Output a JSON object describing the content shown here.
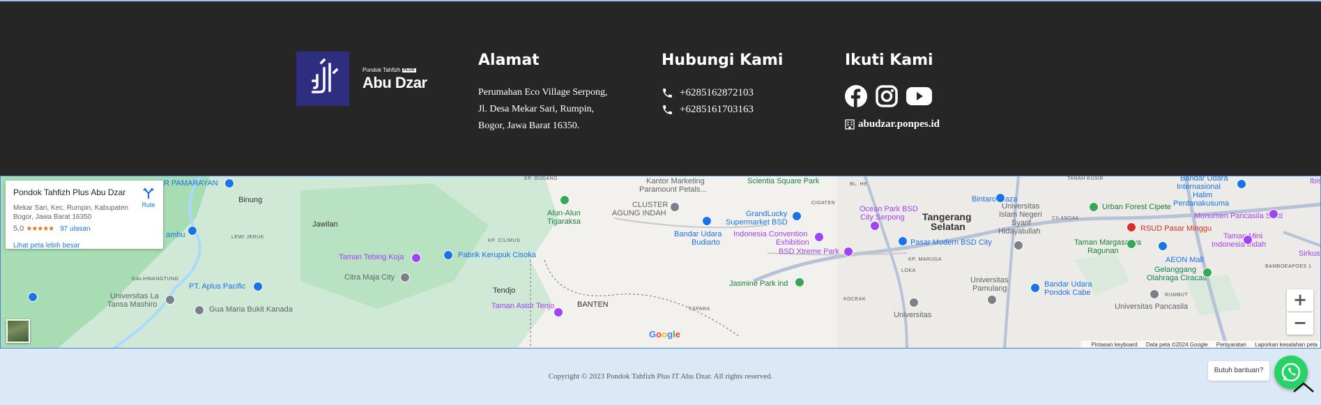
{
  "logo": {
    "small_text": "Pondok Tahfizh",
    "plus_badge": "PLUS",
    "name": "Abu Dzar"
  },
  "address": {
    "title": "Alamat",
    "lines": [
      "Perumahan Eco Village Serpong,",
      "Jl. Desa Mekar Sari, Rumpin,",
      "Bogor, Jawa Barat 16350."
    ]
  },
  "contact": {
    "title": "Hubungi Kami",
    "phones": [
      "+6285162872103",
      "+6285161703163"
    ]
  },
  "social": {
    "title": "Ikuti Kami",
    "icons": [
      "facebook-icon",
      "instagram-icon",
      "youtube-icon"
    ],
    "website": "abudzar.ponpes.id"
  },
  "map": {
    "card": {
      "title": "Pondok Tahfizh Plus Abu Dzar",
      "address": "Mekar Sari, Kec. Rumpin, Kabupaten Bogor, Jawa Barat 16350",
      "rating": "5,0",
      "stars": "★★★★★",
      "reviews": "97 ulasan",
      "larger_map": "Lihat peta lebih besar",
      "route": "Rute"
    },
    "places": [
      {
        "text": "R PAMARAYAN",
        "cls": "p-poi"
      },
      {
        "text": "Binung",
        "cls": "p-town"
      },
      {
        "text": "Jawilan",
        "cls": "p-town"
      },
      {
        "text": "ambu",
        "cls": "p-poi"
      },
      {
        "text": "LEWI JERUK",
        "cls": "p-small"
      },
      {
        "text": "KP. GUDANG",
        "cls": "p-small"
      },
      {
        "text": "Alun-Alun",
        "cls": "p-green"
      },
      {
        "text": "Tigaraksa",
        "cls": "p-green"
      },
      {
        "text": "CLUSTER",
        "cls": "p-gray"
      },
      {
        "text": "AGUNG INDAH",
        "cls": "p-gray"
      },
      {
        "text": "Kantor Marketing",
        "cls": "p-gray"
      },
      {
        "text": "Paramount Petals...",
        "cls": "p-gray"
      },
      {
        "text": "Scientia Square Park",
        "cls": "p-green"
      },
      {
        "text": "BL. H9",
        "cls": "p-small"
      },
      {
        "text": "CIGATEN",
        "cls": "p-small"
      },
      {
        "text": "GrandLucky",
        "cls": "p-poi"
      },
      {
        "text": "Supermarket BSD",
        "cls": "p-poi"
      },
      {
        "text": "Ocean Park BSD",
        "cls": "p-purple"
      },
      {
        "text": "City Serpong",
        "cls": "p-purple"
      },
      {
        "text": "Tangerang",
        "cls": "p-big"
      },
      {
        "text": "Selatan",
        "cls": "p-big"
      },
      {
        "text": "Bintaro Plaza",
        "cls": "p-poi"
      },
      {
        "text": "Universitas",
        "cls": "p-gray"
      },
      {
        "text": "Islam Negeri",
        "cls": "p-gray"
      },
      {
        "text": "Syarif",
        "cls": "p-gray"
      },
      {
        "text": "Hidayatullah",
        "cls": "p-gray"
      },
      {
        "text": "CILANDAK",
        "cls": "p-small"
      },
      {
        "text": "TANAH KUSIR",
        "cls": "p-small"
      },
      {
        "text": "Bandar Udara",
        "cls": "p-poi"
      },
      {
        "text": "Internasional",
        "cls": "p-poi"
      },
      {
        "text": "Halim",
        "cls": "p-poi"
      },
      {
        "text": "Perdanakusuma",
        "cls": "p-poi"
      },
      {
        "text": "Ibis",
        "cls": "p-purple"
      },
      {
        "text": "Urban Forest Cipete",
        "cls": "p-green"
      },
      {
        "text": "Monumen Pancasila Sakti",
        "cls": "p-purple"
      },
      {
        "text": "RSUD Pasar Minggu",
        "cls": "p-red"
      },
      {
        "text": "KP. CILIMUS",
        "cls": "p-small"
      },
      {
        "text": "Bandar Udara",
        "cls": "p-poi"
      },
      {
        "text": "Budiarto",
        "cls": "p-poi"
      },
      {
        "text": "Indonesia Convention",
        "cls": "p-purple"
      },
      {
        "text": "Exhibition",
        "cls": "p-purple"
      },
      {
        "text": "Pasar Modern BSD City",
        "cls": "p-poi"
      },
      {
        "text": "Taman Margasatwa",
        "cls": "p-green"
      },
      {
        "text": "Ragunan",
        "cls": "p-green"
      },
      {
        "text": "Taman Mini",
        "cls": "p-purple"
      },
      {
        "text": "Indonesia Indah",
        "cls": "p-purple"
      },
      {
        "text": "Taman Tebing Koja",
        "cls": "p-purple"
      },
      {
        "text": "Pabrik Kerupuk Cisoka",
        "cls": "p-poi"
      },
      {
        "text": "BSD Xtreme Park",
        "cls": "p-purple"
      },
      {
        "text": "KP. MARUGA",
        "cls": "p-small"
      },
      {
        "text": "AEON Mall",
        "cls": "p-poi"
      },
      {
        "text": "Sirkus Wa",
        "cls": "p-purple"
      },
      {
        "text": "LOKA",
        "cls": "p-small"
      },
      {
        "text": "BAMBOEAPOES 1",
        "cls": "p-small"
      },
      {
        "text": "Gelanggang",
        "cls": "p-teal"
      },
      {
        "text": "Olahraga Ciracas",
        "cls": "p-teal"
      },
      {
        "text": "GALIHNANGTUNG",
        "cls": "p-small"
      },
      {
        "text": "Citra Maja City",
        "cls": "p-gray"
      },
      {
        "text": "PT. Aplus Pacific",
        "cls": "p-poi"
      },
      {
        "text": "Jasmine Park ind",
        "cls": "p-green"
      },
      {
        "text": "Universitas",
        "cls": "p-gray"
      },
      {
        "text": "Pamulang",
        "cls": "p-gray"
      },
      {
        "text": "Bandar Udara",
        "cls": "p-poi"
      },
      {
        "text": "Pondok Cabe",
        "cls": "p-poi"
      },
      {
        "text": "Universitas Pancasila",
        "cls": "p-gray"
      },
      {
        "text": "RUMBUT",
        "cls": "p-small"
      },
      {
        "text": "Tendjo",
        "cls": "p-town"
      },
      {
        "text": "Universitas La",
        "cls": "p-gray"
      },
      {
        "text": "Tansa Mashiro",
        "cls": "p-gray"
      },
      {
        "text": "KOCEAK",
        "cls": "p-small"
      },
      {
        "text": "Taman Astor Tenjo",
        "cls": "p-purple"
      },
      {
        "text": "BANTEN",
        "cls": "p-town"
      },
      {
        "text": "TJIPARA",
        "cls": "p-small"
      },
      {
        "text": "Gua Maria Bukit Kanada",
        "cls": "p-gray"
      },
      {
        "text": "Universitas",
        "cls": "p-gray"
      }
    ],
    "zoom_in": "+",
    "zoom_out": "−",
    "google": "Google",
    "attribution": [
      "Pintasan keyboard",
      "Data peta ©2024 Google",
      "Persyaratan",
      "Laporkan kesalahan peta"
    ]
  },
  "footer": {
    "copyright": "Copyright © 2023 Pondok Tahfizh Plus IT Abu Dzar. All rights reserved.",
    "help": "Butuh bantuan?"
  }
}
